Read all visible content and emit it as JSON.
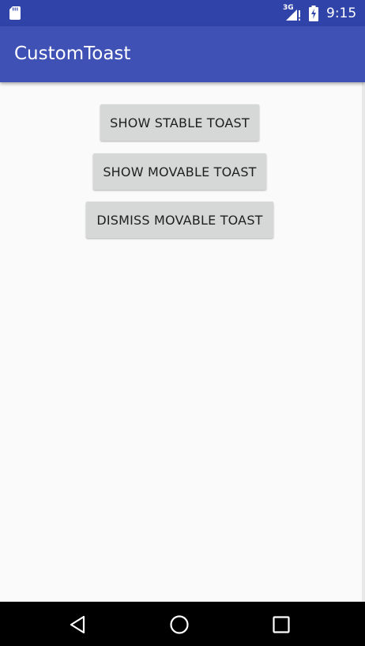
{
  "status_bar": {
    "network_type": "3G",
    "time": "9:15",
    "icons": [
      "sd-card-icon",
      "signal-icon",
      "battery-charging-icon"
    ]
  },
  "app_bar": {
    "title": "CustomToast"
  },
  "buttons": {
    "show_stable": "SHOW STABLE TOAST",
    "show_movable": "SHOW MOVABLE TOAST",
    "dismiss_movable": "DISMISS MOVABLE TOAST"
  },
  "nav_bar": {
    "icons": [
      "back-icon",
      "home-icon",
      "recents-icon"
    ]
  },
  "colors": {
    "status_bar": "#3043a8",
    "app_bar": "#3f51b5",
    "background": "#fafafa",
    "button": "#d6d7d7",
    "nav_bar": "#000000"
  }
}
